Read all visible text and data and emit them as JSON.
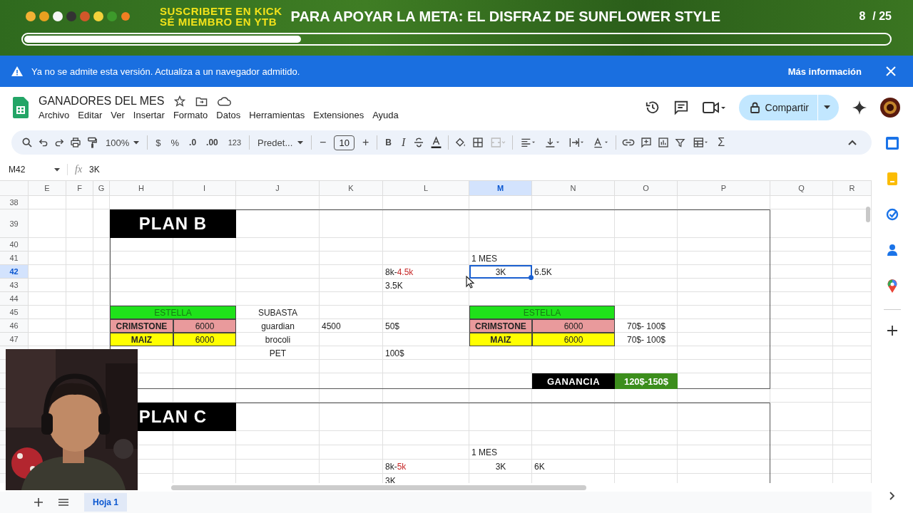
{
  "stream_overlay": {
    "lines": [
      "SUSCRIBETE EN KICK",
      "SÉ MIEMBRO EN YTB"
    ],
    "goal": "PARA APOYAR LA META:  EL DISFRAZ DE SUNFLOWER STYLE",
    "count": "8",
    "total": "/ 25",
    "level": 0.32
  },
  "banner": {
    "message": "Ya no se admite esta versión. Actualiza a un navegador admitido.",
    "link": "Más información"
  },
  "document": {
    "title": "GANADORES DEL MES",
    "menu": [
      "Archivo",
      "Editar",
      "Ver",
      "Insertar",
      "Formato",
      "Datos",
      "Herramientas",
      "Extensiones",
      "Ayuda"
    ],
    "share": "Compartir"
  },
  "toolbar": {
    "zoom": "100%",
    "currency": "$",
    "percent": "%",
    "decrease_decimals": ".0",
    "increase_decimals": ".00",
    "number_format": "123",
    "font": "Predet...",
    "minus": "−",
    "font_size": "10",
    "plus": "+",
    "bold": "B",
    "italic": "I",
    "sum": "Σ"
  },
  "formula_bar": {
    "cell_ref": "M42",
    "fx": "fx",
    "value": "3K"
  },
  "grid": {
    "columns": [
      {
        "label": "E",
        "selected": false
      },
      {
        "label": "F",
        "selected": false
      },
      {
        "label": "G",
        "selected": false
      },
      {
        "label": "H",
        "selected": false
      },
      {
        "label": "I",
        "selected": false
      },
      {
        "label": "J",
        "selected": false
      },
      {
        "label": "K",
        "selected": false
      },
      {
        "label": "L",
        "selected": false
      },
      {
        "label": "M",
        "selected": true
      },
      {
        "label": "N",
        "selected": false
      },
      {
        "label": "O",
        "selected": false
      },
      {
        "label": "P",
        "selected": false
      },
      {
        "label": "Q",
        "selected": false
      },
      {
        "label": "R",
        "selected": false
      }
    ],
    "rows": [
      {
        "label": "38",
        "selected": false
      },
      {
        "label": "39",
        "selected": false
      },
      {
        "label": "40",
        "selected": false
      },
      {
        "label": "41",
        "selected": false
      },
      {
        "label": "42",
        "selected": true
      },
      {
        "label": "43",
        "selected": false
      },
      {
        "label": "44",
        "selected": false
      },
      {
        "label": "45",
        "selected": false
      },
      {
        "label": "46",
        "selected": false
      },
      {
        "label": "47",
        "selected": false
      }
    ]
  },
  "plan_b": {
    "title": "PLAN B",
    "month_label": "1 MES",
    "range": {
      "start": "8k-",
      "end": "4.5k"
    },
    "current": {
      "value": "3K",
      "selected": true
    },
    "target": "6.5K",
    "remaining": "3.5K",
    "stock": {
      "header": "ESTELLA",
      "items": [
        {
          "name": "CRIMSTONE",
          "amount": "6000",
          "kind": "crimstone"
        },
        {
          "name": "MAIZ",
          "amount": "6000",
          "kind": "maiz"
        }
      ]
    },
    "auction": {
      "header": "SUBASTA",
      "items": [
        {
          "name": "guardian",
          "quantity": "4500",
          "price": "50$"
        },
        {
          "name": "brocoli"
        },
        {
          "name": "PET",
          "price": "100$"
        }
      ]
    },
    "stock_2": {
      "header": "ESTELLA",
      "items": [
        {
          "name": "CRIMSTONE",
          "amount": "6000",
          "kind": "crimstone",
          "price": "70$- 100$"
        },
        {
          "name": "MAIZ",
          "amount": "6000",
          "kind": "maiz",
          "price": "70$- 100$"
        }
      ]
    },
    "profit": {
      "label": "GANANCIA",
      "value": "120$-150$"
    }
  },
  "plan_c": {
    "title": "PLAN C",
    "month_label": "1 MES",
    "range": {
      "start": "8k-",
      "end": "5k"
    },
    "current": {
      "value": "3K",
      "selected": false
    },
    "target": "6K",
    "remaining": "3K"
  },
  "sheets": [
    {
      "label": "Hoja 1",
      "selected": true
    }
  ]
}
